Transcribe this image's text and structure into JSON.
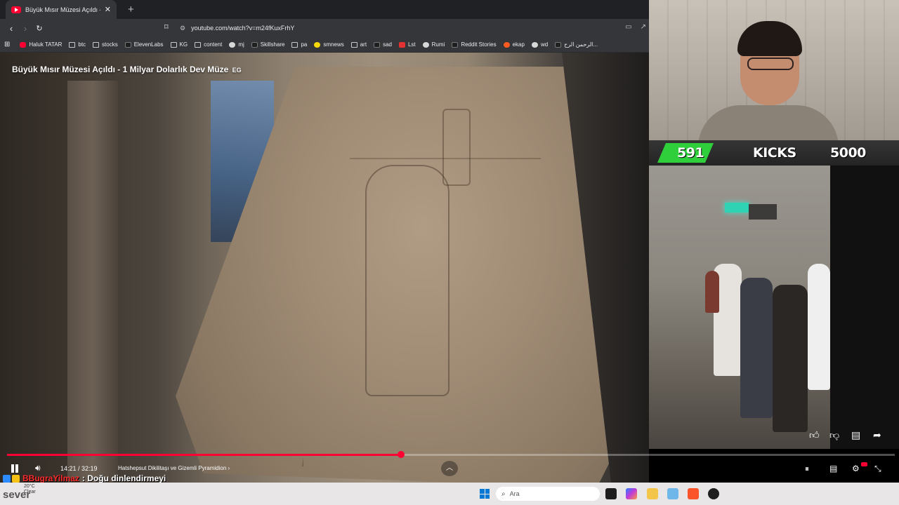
{
  "browser": {
    "tab": {
      "title": "Büyük Mısır Müzesi Açıldı - 1",
      "close_icon": "close-icon"
    },
    "new_tab_icon": "plus-icon",
    "url": "youtube.com/watch?v=m24fKuxFrhY",
    "bookmarks": [
      {
        "label": "Haluk TATAR",
        "icon": "yt"
      },
      {
        "label": "btc",
        "icon": "folder"
      },
      {
        "label": "stocks",
        "icon": "folder"
      },
      {
        "label": "ElevenLabs",
        "icon": "dark"
      },
      {
        "label": "KG",
        "icon": "folder"
      },
      {
        "label": "content",
        "icon": "folder"
      },
      {
        "label": "mj",
        "icon": "round"
      },
      {
        "label": "Skillshare",
        "icon": "dark"
      },
      {
        "label": "pa",
        "icon": "folder"
      },
      {
        "label": "smnews",
        "icon": "yellow"
      },
      {
        "label": "art",
        "icon": "folder"
      },
      {
        "label": "sad",
        "icon": "dark"
      },
      {
        "label": "Lst",
        "icon": "red"
      },
      {
        "label": "Rumi",
        "icon": "round"
      },
      {
        "label": "Reddit Stories",
        "icon": "dark"
      },
      {
        "label": "ekap",
        "icon": "orange"
      },
      {
        "label": "wd",
        "icon": "round"
      },
      {
        "label": "الرحمن الرح...",
        "icon": "dark"
      }
    ]
  },
  "video": {
    "title": "Büyük Mısır Müzesi Açıldı - 1 Milyar Dolarlık Dev Müze",
    "title_flag": "EG",
    "time": "14:21 / 32:19",
    "chapter": "Hatshepsut Dikilitaşı ve Gizemli Pyramidion",
    "progress_fraction": 0.4442
  },
  "stream": {
    "kick_left": "591",
    "kick_label": "KICKS",
    "kick_right": "5000"
  },
  "chat": {
    "user": "BBugraYilmaz",
    "message": ": Doğu dinlendirmeyi"
  },
  "taskbar": {
    "weather_temp": "20°C",
    "weather_desc": "Clear",
    "overlay_text": "sever",
    "search_placeholder": "Ara"
  },
  "colors": {
    "accent": "#ff0033",
    "kick_green": "#2fcf3b",
    "chat_user": "#ff2c2c"
  }
}
